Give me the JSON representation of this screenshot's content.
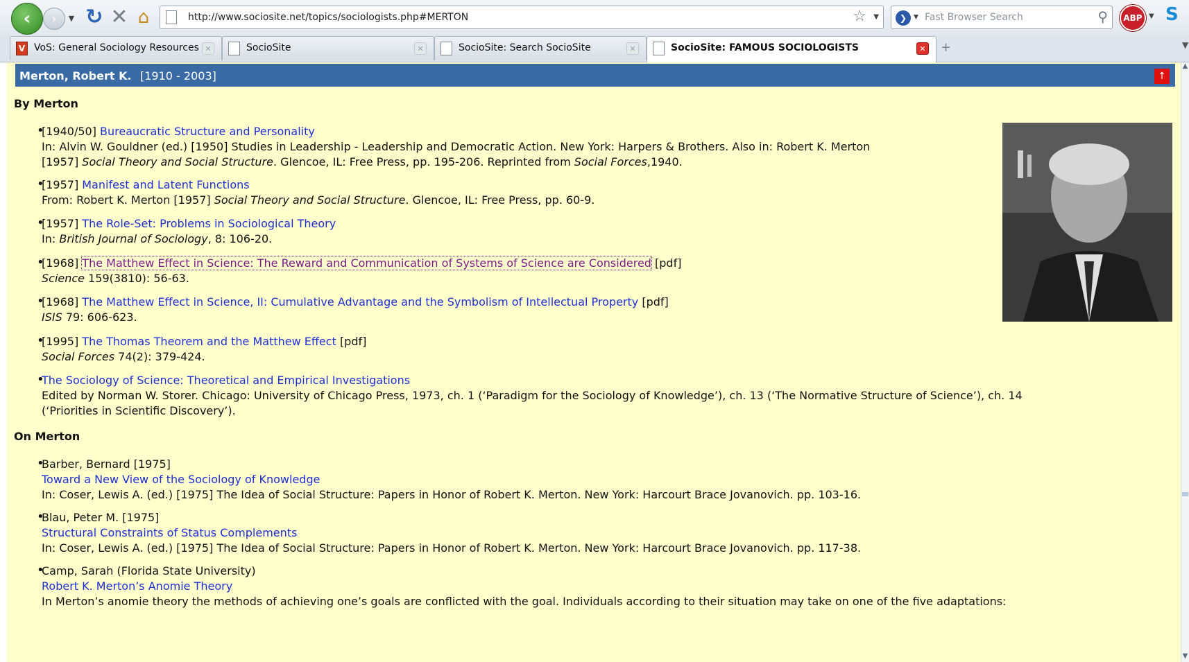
{
  "browser": {
    "url": "http://www.sociosite.net/topics/sociologists.php#MERTON",
    "search_placeholder": "Fast Browser Search",
    "abp_label": "ABP",
    "tabs": [
      {
        "label": "VoS: General Sociology Resources",
        "icon": "vos-icon",
        "active": false
      },
      {
        "label": "SocioSite",
        "icon": "page-icon",
        "active": false
      },
      {
        "label": "SocioSite: Search SocioSite",
        "icon": "page-icon",
        "active": false
      },
      {
        "label": "SocioSite: FAMOUS SOCIOLOGISTS",
        "icon": "page-icon",
        "active": true
      }
    ],
    "icons": [
      "back-icon",
      "forward-icon",
      "reload-icon",
      "stop-icon",
      "home-icon",
      "star-icon",
      "search-icon",
      "new-tab-icon"
    ]
  },
  "page": {
    "background": "#ffffcc",
    "header": {
      "name": "Merton, Robert K.",
      "years": "[1910 - 2003]",
      "bar_color": "#3a6aa3"
    },
    "by_heading": "By Merton",
    "by": [
      {
        "year": "[1940/50]",
        "link": "Bureaucratic Structure and Personality",
        "pdf": "",
        "src": "In: Alvin W. Gouldner (ed.) [1950] Studies in Leadership - Leadership and Democratic Action. New York: Harpers & Brothers. Also in: Robert K. Merton",
        "src2a": "[1957] ",
        "src2b": "Social Theory and Social Structure",
        "src2c": ". Glencoe, IL: Free Press, pp. 195-206. Reprinted from ",
        "src2d": "Social Forces",
        "src2e": ",1940."
      },
      {
        "year": "[1957]",
        "link": "Manifest and Latent Functions",
        "src_a": "From: Robert K. Merton [1957] ",
        "src_b": "Social Theory and Social Structure",
        "src_c": ". Glencoe, IL: Free Press, pp. 60-9."
      },
      {
        "year": "[1957]",
        "link": "The Role-Set: Problems in Sociological Theory",
        "src_a": "In: ",
        "src_b": "British Journal of Sociology",
        "src_c": ", 8: 106-20."
      },
      {
        "year": "[1968]",
        "link": "The Matthew Effect in Science: The Reward and Communication of Systems of Science are Considered",
        "pdf": "[pdf]",
        "src_b": "Science",
        "src_c": " 159(3810): 56-63."
      },
      {
        "year": "[1968]",
        "link": "The Matthew Effect in Science, II: Cumulative Advantage and the Symbolism of Intellectual Property",
        "pdf": "[pdf]",
        "src_b": "ISIS",
        "src_c": " 79: 606-623."
      },
      {
        "year": "[1995]",
        "link": "The Thomas Theorem and the Matthew Effect",
        "pdf": "[pdf]",
        "src_b": "Social Forces",
        "src_c": " 74(2): 379-424."
      },
      {
        "link": "The Sociology of Science: Theoretical and Empirical Investigations",
        "src_a": "Edited by Norman W. Storer. Chicago: University of Chicago Press, 1973, ch. 1 (‘Paradigm for the Sociology of Knowledge’), ch. 13 (‘The Normative Structure of Science’), ch. 14",
        "src_b": "(‘Priorities in Scientific Discovery’)."
      }
    ],
    "on_heading": "On Merton",
    "on": [
      {
        "author": "Barber, Bernard [1975]",
        "link": "Toward a New View of the Sociology of Knowledge",
        "src": "In: Coser, Lewis A. (ed.) [1975] The Idea of Social Structure: Papers in Honor of Robert K. Merton. New York: Harcourt Brace Jovanovich. pp. 103-16."
      },
      {
        "author": "Blau, Peter M. [1975]",
        "link": "Structural Constraints of Status Complements",
        "src": "In: Coser, Lewis A. (ed.) [1975] The Idea of Social Structure: Papers in Honor of Robert K. Merton. New York: Harcourt Brace Jovanovich. pp. 117-38."
      },
      {
        "author": "Camp, Sarah (Florida State University)",
        "link": "Robert K. Merton’s Anomie Theory",
        "src": "In Merton’s anomie theory the methods of achieving one’s goals are conflicted with the goal. Individuals according to their situation may take on one of the five adaptations:"
      }
    ]
  }
}
